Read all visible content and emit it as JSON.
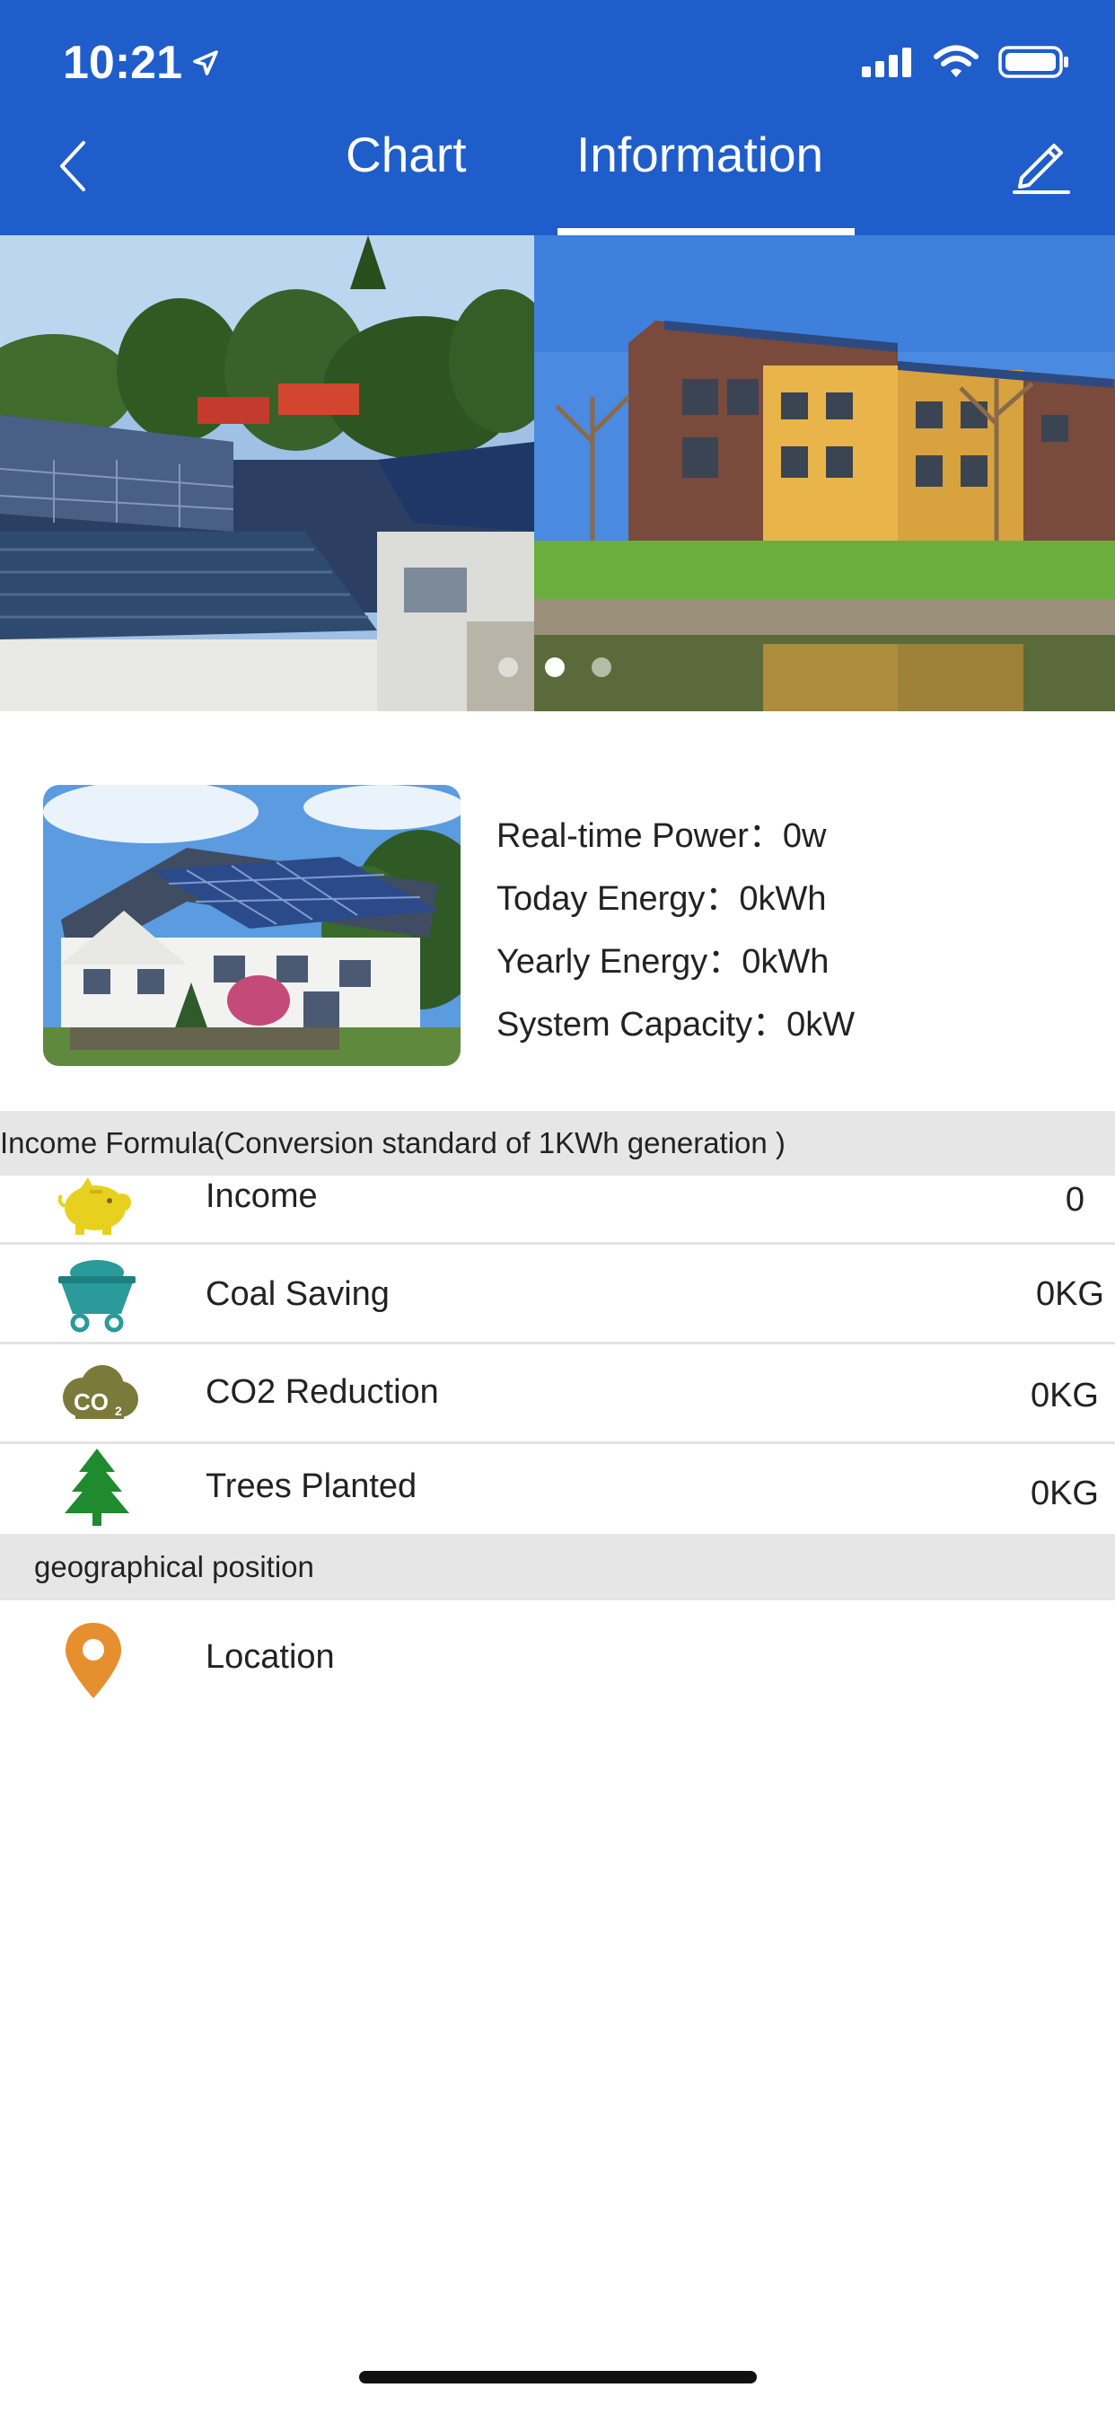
{
  "status_bar": {
    "time": "10:21"
  },
  "tabs": {
    "chart": "Chart",
    "information": "Information",
    "active": "information"
  },
  "banner": {
    "slide_count": 3,
    "active_slide": 2
  },
  "summary": {
    "realtime_power_label": "Real-time Power：",
    "realtime_power_value": "0w",
    "today_energy_label": "Today Energy：",
    "today_energy_value": "0kWh",
    "yearly_energy_label": "Yearly Energy：",
    "yearly_energy_value": "0kWh",
    "system_capacity_label": "System Capacity：",
    "system_capacity_value": "0kW"
  },
  "income_section": {
    "title": "Income Formula(Conversion standard of 1KWh generation )",
    "rows": [
      {
        "icon": "piggy-bank-icon",
        "label": "Income",
        "value": "0"
      },
      {
        "icon": "coal-cart-icon",
        "label": "Coal Saving",
        "value": "0KG"
      },
      {
        "icon": "co2-cloud-icon",
        "label": "CO2 Reduction",
        "value": "0KG"
      },
      {
        "icon": "tree-icon",
        "label": "Trees Planted",
        "value": "0KG"
      }
    ]
  },
  "geo_section": {
    "title": "geographical position",
    "location_label": "Location"
  },
  "colors": {
    "header_blue": "#1f5dca",
    "piggy_yellow": "#e8d11e",
    "cart_teal": "#2a9a9a",
    "co2_olive": "#7a7a3a",
    "tree_green": "#1f8a2e",
    "pin_orange": "#e58f2e"
  }
}
